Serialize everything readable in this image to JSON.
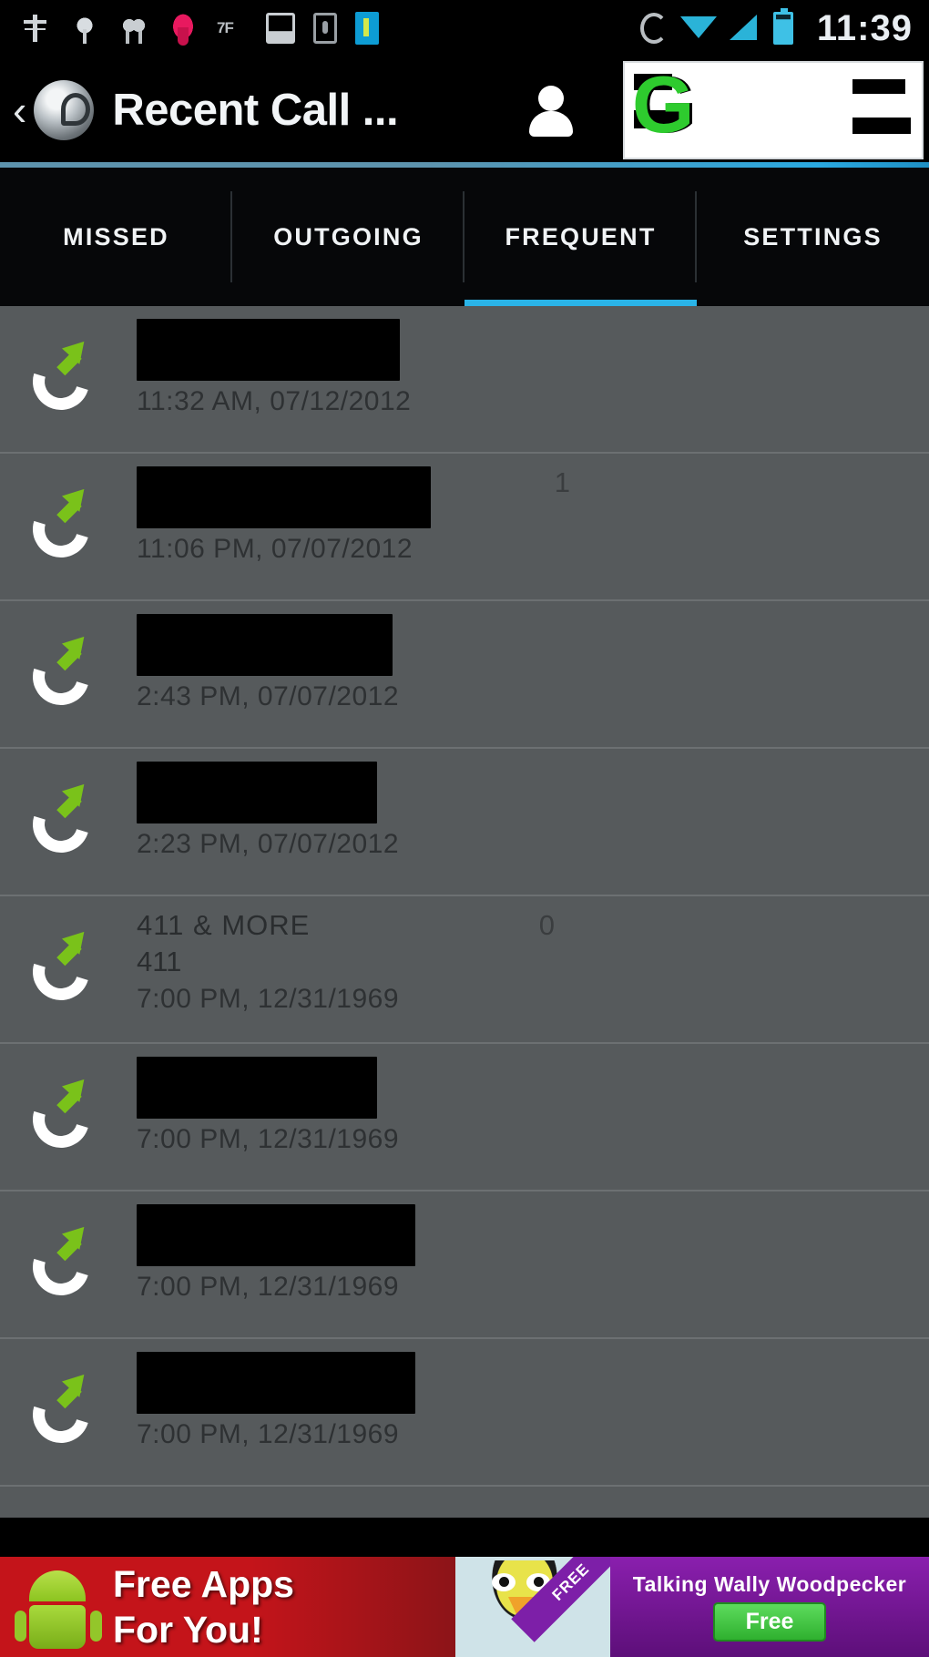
{
  "statusbar": {
    "clock": "11:39",
    "left_icons": [
      "usb-icon",
      "developer-icon",
      "developer-alt-icon",
      "pink-app-icon",
      "temperature-icon",
      "screenshot-icon",
      "sim-card-icon",
      "blue-app-icon"
    ],
    "right_icons": [
      "auto-rotate-icon",
      "wifi-icon",
      "cellular-signal-icon",
      "battery-icon"
    ]
  },
  "actionbar": {
    "back_label": "‹",
    "app_icon_name": "app-logo-icon",
    "title": "Recent Call ...",
    "contacts_icon_name": "person-icon",
    "banner_text": "G"
  },
  "tabs": [
    {
      "label": "MISSED",
      "active": false
    },
    {
      "label": "OUTGOING",
      "active": false
    },
    {
      "label": "FREQUENT",
      "active": true
    },
    {
      "label": "SETTINGS",
      "active": false
    }
  ],
  "call_list": [
    {
      "type": "outgoing",
      "name": "",
      "redacted": true,
      "redact_width": "34%",
      "meta": "11:32 AM, 07/12/2012",
      "count": ""
    },
    {
      "type": "outgoing",
      "name": "",
      "redacted": true,
      "redact_width": "38%",
      "meta": "11:06 PM, 07/07/2012",
      "count": "1"
    },
    {
      "type": "outgoing",
      "name": "",
      "redacted": true,
      "redact_width": "33%",
      "meta": "2:43 PM, 07/07/2012",
      "count": ""
    },
    {
      "type": "outgoing",
      "name": "",
      "redacted": true,
      "redact_width": "31%",
      "meta": "2:23 PM, 07/07/2012",
      "count": ""
    },
    {
      "type": "outgoing",
      "name": "411 & MORE",
      "redacted": false,
      "sub": "411",
      "meta": "7:00 PM, 12/31/1969",
      "count": "0"
    },
    {
      "type": "outgoing",
      "name": "",
      "redacted": true,
      "redact_width": "31%",
      "meta": "7:00 PM, 12/31/1969",
      "count": ""
    },
    {
      "type": "outgoing",
      "name": "",
      "redacted": true,
      "redact_width": "36%",
      "meta": "7:00 PM, 12/31/1969",
      "count": ""
    },
    {
      "type": "outgoing",
      "name": "",
      "redacted": true,
      "redact_width": "36%",
      "meta": "7:00 PM, 12/31/1969",
      "count": ""
    }
  ],
  "bottom_ad": {
    "left_line1": "Free Apps",
    "left_line2": "For You!",
    "ribbon": "FREE",
    "right_title": "Talking Wally Woodpecker",
    "right_button": "Free"
  },
  "colors": {
    "accent": "#2ab4e8",
    "list_bg": "#565a5c",
    "call_arrow": "#7ac21a",
    "ad_red": "#c4141a",
    "ad_purple": "#8a1fae"
  }
}
